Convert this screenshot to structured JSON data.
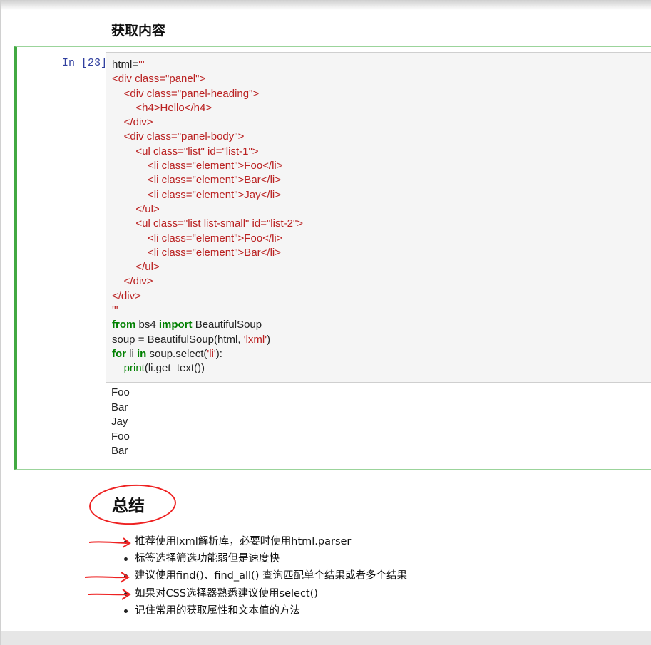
{
  "section_heading": "获取内容",
  "cell": {
    "prompt": "In [23]:",
    "code_lines": [
      [
        {
          "t": "html=",
          "c": ""
        },
        {
          "t": "'''",
          "c": "str"
        }
      ],
      [
        {
          "t": "<div class=\"panel\">",
          "c": "str"
        }
      ],
      [
        {
          "t": "    <div class=\"panel-heading\">",
          "c": "str"
        }
      ],
      [
        {
          "t": "        <h4>Hello</h4>",
          "c": "str"
        }
      ],
      [
        {
          "t": "    </div>",
          "c": "str"
        }
      ],
      [
        {
          "t": "    <div class=\"panel-body\">",
          "c": "str"
        }
      ],
      [
        {
          "t": "        <ul class=\"list\" id=\"list-1\">",
          "c": "str"
        }
      ],
      [
        {
          "t": "            <li class=\"element\">Foo</li>",
          "c": "str"
        }
      ],
      [
        {
          "t": "            <li class=\"element\">Bar</li>",
          "c": "str"
        }
      ],
      [
        {
          "t": "            <li class=\"element\">Jay</li>",
          "c": "str"
        }
      ],
      [
        {
          "t": "        </ul>",
          "c": "str"
        }
      ],
      [
        {
          "t": "        <ul class=\"list list-small\" id=\"list-2\">",
          "c": "str"
        }
      ],
      [
        {
          "t": "            <li class=\"element\">Foo</li>",
          "c": "str"
        }
      ],
      [
        {
          "t": "            <li class=\"element\">Bar</li>",
          "c": "str"
        }
      ],
      [
        {
          "t": "        </ul>",
          "c": "str"
        }
      ],
      [
        {
          "t": "    </div>",
          "c": "str"
        }
      ],
      [
        {
          "t": "</div>",
          "c": "str"
        }
      ],
      [
        {
          "t": "'''",
          "c": "str"
        }
      ],
      [
        {
          "t": "from",
          "c": "kw"
        },
        {
          "t": " bs4 ",
          "c": ""
        },
        {
          "t": "import",
          "c": "kw"
        },
        {
          "t": " BeautifulSoup",
          "c": ""
        }
      ],
      [
        {
          "t": "soup = BeautifulSoup(html, ",
          "c": ""
        },
        {
          "t": "'lxml'",
          "c": "str"
        },
        {
          "t": ")",
          "c": ""
        }
      ],
      [
        {
          "t": "for",
          "c": "kw"
        },
        {
          "t": " li ",
          "c": ""
        },
        {
          "t": "in",
          "c": "kw"
        },
        {
          "t": " soup.select(",
          "c": ""
        },
        {
          "t": "'li'",
          "c": "str"
        },
        {
          "t": "):",
          "c": ""
        }
      ],
      [
        {
          "t": "    ",
          "c": ""
        },
        {
          "t": "print",
          "c": "bi"
        },
        {
          "t": "(li.get_text())",
          "c": ""
        }
      ]
    ],
    "output_lines": [
      "Foo",
      "Bar",
      "Jay",
      "Foo",
      "Bar"
    ]
  },
  "summary": {
    "title": "总结",
    "bullets": [
      "推荐使用lxml解析库，必要时使用html.parser",
      "标签选择筛选功能弱但是速度快",
      "建议使用find()、find_all() 查询匹配单个结果或者多个结果",
      "如果对CSS选择器熟悉建议使用select()",
      "记住常用的获取属性和文本值的方法"
    ]
  },
  "colors": {
    "cell_border": "#42a942",
    "string": "#ba2121",
    "keyword": "#008000",
    "annotation": "#e22222"
  }
}
